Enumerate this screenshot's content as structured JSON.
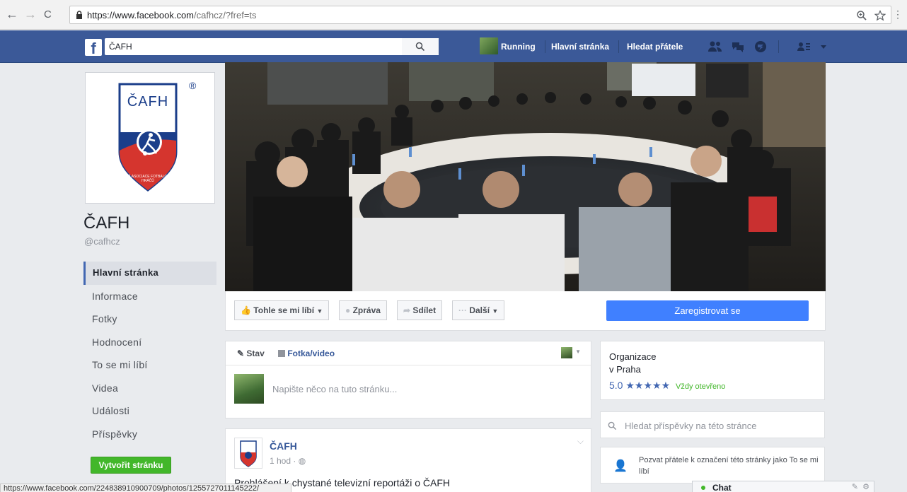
{
  "browser": {
    "back": "←",
    "forward": "→",
    "reload": "C",
    "url_host": "https://www.facebook.com",
    "url_path": "/cafhcz/?fref=ts",
    "zoom_icon": "zoom-icon",
    "star_icon": "star-icon",
    "menu": "⋮"
  },
  "topbar": {
    "logo": "f",
    "search_value": "ČAFH",
    "links": [
      "Running",
      "Hlavní stránka",
      "Hledat přátele"
    ]
  },
  "page": {
    "logo_text": "ČAFH",
    "logo_reg": "®",
    "logo_sub": "ČESKÁ ASOCIACE FOTBALOVÝCH HRÁČŮ",
    "name": "ČAFH",
    "handle": "@cafhcz"
  },
  "leftnav": {
    "items": [
      "Hlavní stránka",
      "Informace",
      "Fotky",
      "Hodnocení",
      "To se mi líbí",
      "Videa",
      "Události",
      "Příspěvky"
    ],
    "create_button": "Vytvořit stránku"
  },
  "actions": {
    "like": "Tohle se mi líbí",
    "message": "Zpráva",
    "share": "Sdílet",
    "more": "Další",
    "register": "Zaregistrovat se"
  },
  "composer": {
    "tab_status": "Stav",
    "tab_photo": "Fotka/video",
    "placeholder": "Napište něco na tuto stránku..."
  },
  "post": {
    "author": "ČAFH",
    "time": "1 hod ·",
    "text": "Prohlášení k chystané televizní reportáži o ČAFH"
  },
  "info": {
    "category": "Organizace",
    "location": "v Praha",
    "rating": "5.0",
    "stars": "★★★★★",
    "open": "Vždy otevřeno"
  },
  "search_posts": {
    "placeholder": "Hledat příspěvky na této stránce"
  },
  "invite": {
    "text": "Pozvat přátele k označení této stránky jako To se mi líbí"
  },
  "chat": {
    "label": "Chat",
    "status_color": "#42b72a"
  },
  "status_url": "https://www.facebook.com/224838910900709/photos/1255727011145222/",
  "colors": {
    "fb_blue": "#3b5998",
    "link_blue": "#365899",
    "button_blue": "#4080ff",
    "green": "#42b72a"
  }
}
